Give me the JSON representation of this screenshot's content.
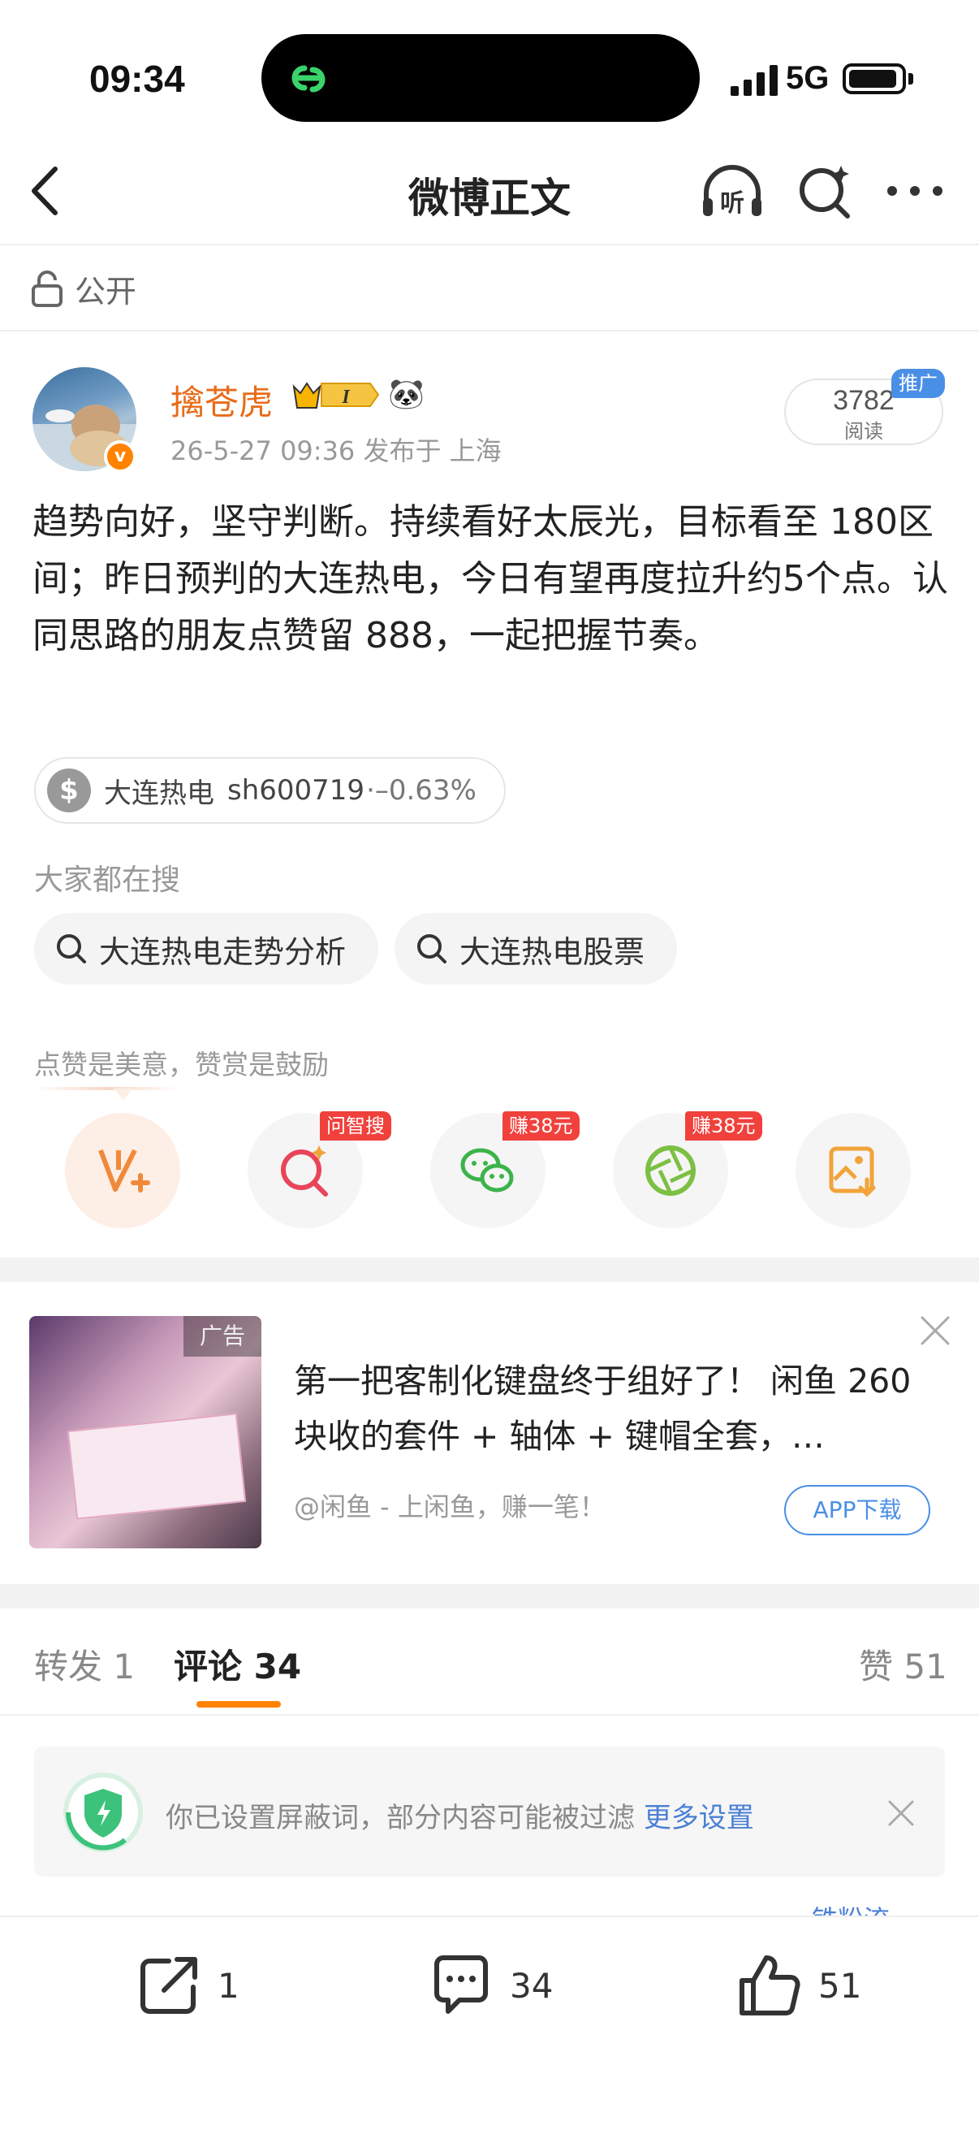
{
  "status_bar": {
    "time": "09:34",
    "network": "5G"
  },
  "nav": {
    "title": "微博正文",
    "listen_label": "听"
  },
  "visibility": {
    "label": "公开"
  },
  "author": {
    "name": "擒苍虎",
    "vip_level": "I",
    "meta": "26-5-27 09:36  发布于 上海",
    "read_count": "3782",
    "read_label": "阅读",
    "promo_badge": "推广"
  },
  "post": {
    "text": "趋势向好，坚守判断。持续看好太辰光，目标看至 180区间；昨日预判的大连热电，今日有望再度拉升约5个点。认同思路的朋友点赞留 888，一起把握节奏。"
  },
  "stock_tag": {
    "name": "大连热电",
    "code": "sh600719",
    "change": "·–0.63%"
  },
  "searching": {
    "label": "大家都在搜",
    "chips": [
      "大连热电走势分析",
      "大连热电股票"
    ]
  },
  "reward": {
    "text": "点赞是美意，赞赏是鼓励",
    "tags": [
      "问智搜",
      "赚38元",
      "赚38元"
    ]
  },
  "ad": {
    "tag": "广告",
    "title": "第一把客制化键盘终于组好了！ 闲鱼 260 块收的套件 + 轴体 + 键帽全套，…",
    "source": "@闲鱼 - 上闲鱼，赚一笔！",
    "button": "APP下载"
  },
  "tabs": {
    "repost": "转发 1",
    "comment": "评论 34",
    "like": "赞 51"
  },
  "filter_notice": {
    "text": "你已设置屏蔽词，部分内容可能被过滤 ",
    "link": "更多设置"
  },
  "peek_text": "铁粉流",
  "bottom_bar": {
    "repost_count": "1",
    "comment_count": "34",
    "like_count": "51"
  },
  "colors": {
    "accent": "#ff8200",
    "author_name": "#e86c19",
    "link": "#4a7fd6",
    "tag_red": "#f0413c"
  }
}
